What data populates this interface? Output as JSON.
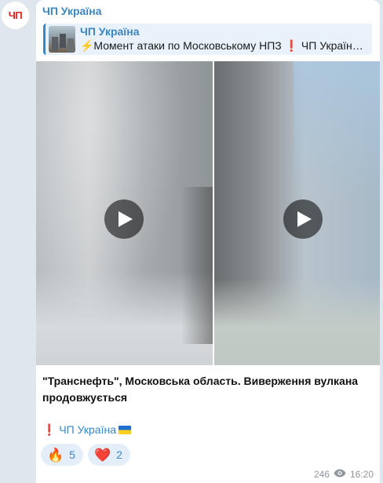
{
  "channel": {
    "avatar_text": "ЧП",
    "name": "ЧП Україна"
  },
  "reply": {
    "title": "ЧП Україна",
    "text": "⚡Момент атаки по Московському НПЗ ❗ ЧП Україн…🇺🇦"
  },
  "media": {
    "items": [
      "video-1",
      "video-2"
    ]
  },
  "caption": {
    "text": "\"Транснефть\", Московська область. Виверження вулкана продовжується",
    "footer_mark": "❗",
    "footer_link": "ЧП Україна"
  },
  "reactions": [
    {
      "emoji": "🔥",
      "count": "5"
    },
    {
      "emoji": "❤️",
      "count": "2"
    }
  ],
  "meta": {
    "views": "246",
    "time": "16:20"
  },
  "colors": {
    "accent": "#3a86c4",
    "brand_red": "#e0241b",
    "background": "#dfe7ee"
  }
}
